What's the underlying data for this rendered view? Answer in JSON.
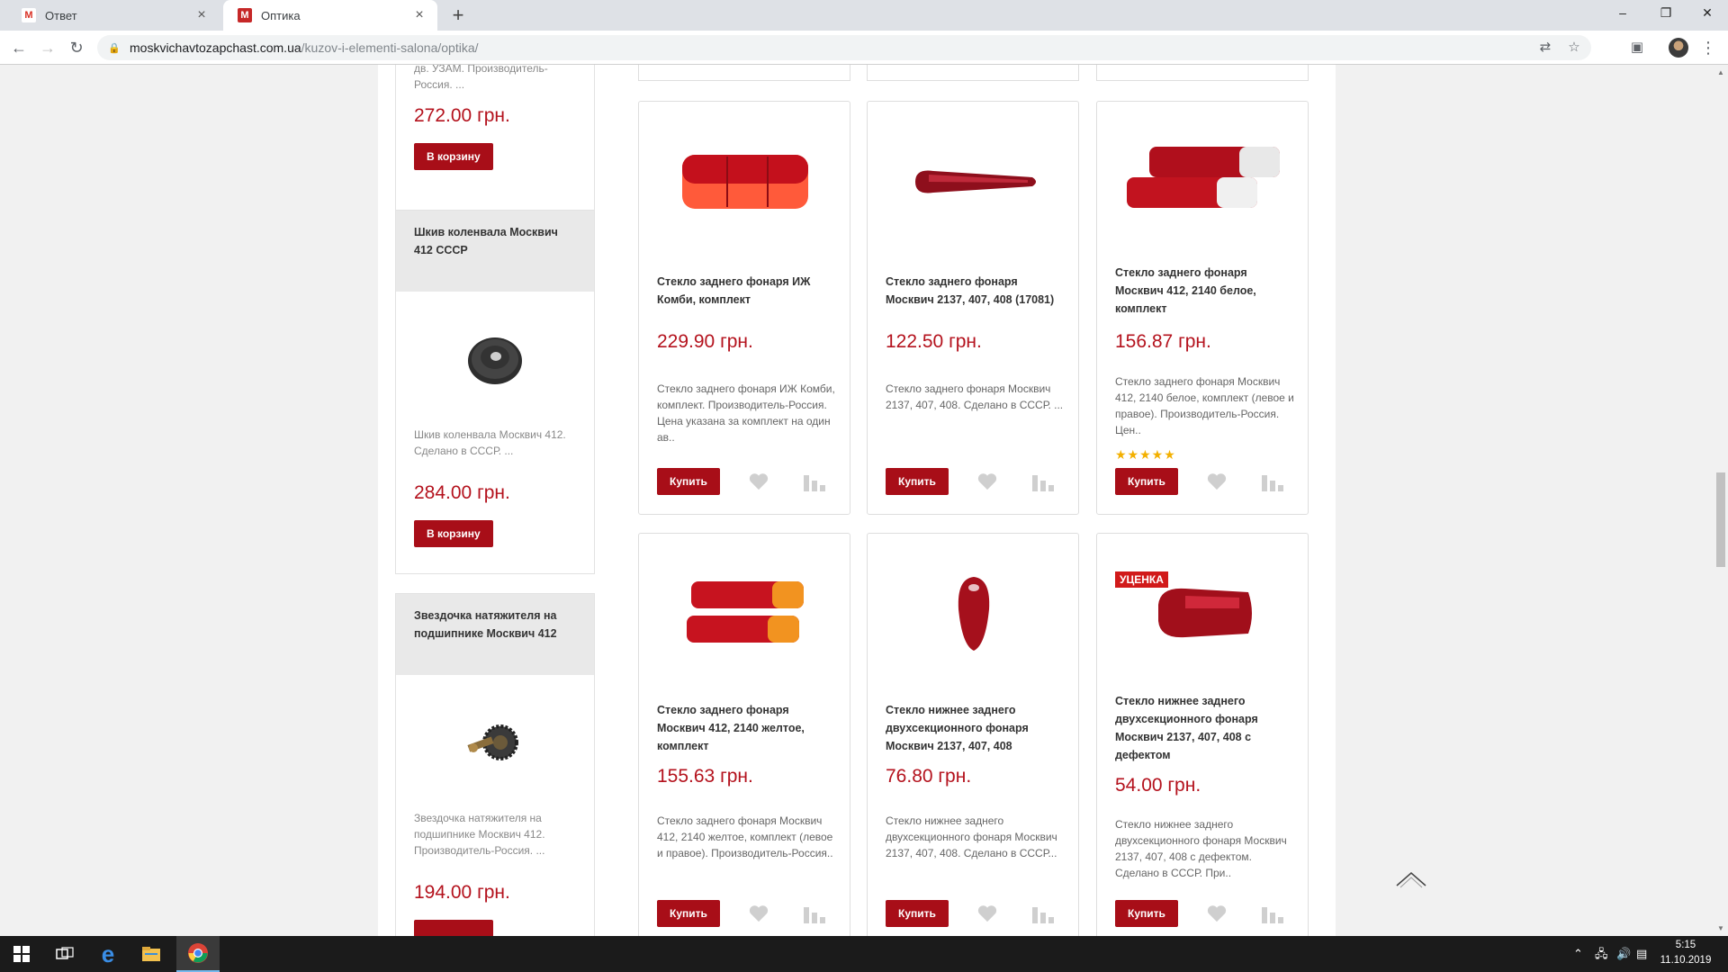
{
  "browser": {
    "tabs": [
      {
        "title": "Ответ",
        "favicon": "gmail-icon"
      },
      {
        "title": "Оптика",
        "favicon": "M"
      }
    ],
    "new_tab": "+",
    "url_host": "moskvichavtozapchast.com.ua",
    "url_path": "/kuzov-i-elementi-salona/optika/"
  },
  "sidebar": {
    "cards": [
      {
        "desc": "дв. УЗАМ. Производитель-Россия. ...",
        "price": "272.00 грн.",
        "button": "В корзину"
      },
      {
        "title": "Шкив коленвала Москвич 412 СССР",
        "desc": "Шкив коленвала Москвич 412. Сделано в СССР. ...",
        "price": "284.00 грн.",
        "button": "В корзину"
      },
      {
        "title": "Звездочка натяжителя на подшипнике Москвич 412",
        "desc": "Звездочка натяжителя на подшипнике Москвич 412. Производитель-Россия. ...",
        "price": "194.00 грн."
      }
    ]
  },
  "products": [
    {
      "title": "Стекло заднего фонаря ИЖ Комби, комплект",
      "price": "229.90 грн.",
      "desc": "Стекло заднего фонаря ИЖ Комби, комплект. Производитель-Россия. Цена указана за комплект на один ав..",
      "buy": "Купить"
    },
    {
      "title": "Стекло заднего фонаря Москвич 2137, 407, 408 (17081)",
      "price": "122.50 грн.",
      "desc": "Стекло заднего фонаря Москвич 2137, 407, 408. Сделано в СССР. ...",
      "buy": "Купить"
    },
    {
      "title": "Стекло заднего фонаря Москвич 412, 2140 белое, комплект",
      "price": "156.87 грн.",
      "desc": "Стекло заднего фонаря Москвич 412, 2140 белое, комплект (левое и правое). Производитель-Россия. Цен..",
      "buy": "Купить",
      "rating": 5
    },
    {
      "title": "Стекло заднего фонаря Москвич 412, 2140 желтое, комплект",
      "price": "155.63 грн.",
      "desc": "Стекло заднего фонаря Москвич 412, 2140 желтое, комплект (левое и правое). Производитель-Россия..",
      "buy": "Купить"
    },
    {
      "title": "Стекло нижнее заднего двухсекционного фонаря Москвич 2137, 407, 408",
      "price": "76.80 грн.",
      "desc": "Стекло нижнее заднего двухсекционного фонаря Москвич 2137, 407, 408. Сделано в СССР...",
      "buy": "Купить"
    },
    {
      "title": "Стекло нижнее заднего двухсекционного фонаря Москвич 2137, 407, 408 с дефектом",
      "price": "54.00 грн.",
      "desc": "Стекло нижнее заднего двухсекционного фонаря Москвич 2137, 407, 408 с дефектом. Сделано в СССР. При..",
      "buy": "Купить",
      "badge": "УЦЕНКА"
    }
  ],
  "taskbar": {
    "time": "5:15",
    "date": "11.10.2019"
  },
  "colors": {
    "accent": "#a80e18",
    "price": "#b4121d"
  }
}
